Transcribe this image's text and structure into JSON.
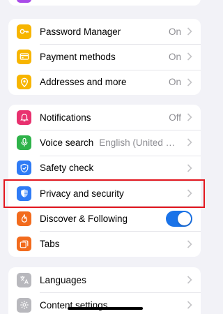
{
  "colors": {
    "background": "#f2f2f7",
    "highlight_border": "#e3171f",
    "toggle_on": "#1a73e8",
    "secondary_text": "#8e8e93"
  },
  "autofill_group": [
    {
      "label": "Password Manager",
      "value": "On",
      "icon": "key-icon",
      "icon_color": "#f7b500"
    },
    {
      "label": "Payment methods",
      "value": "On",
      "icon": "credit-card-icon",
      "icon_color": "#f7b500"
    },
    {
      "label": "Addresses and more",
      "value": "On",
      "icon": "location-pin-icon",
      "icon_color": "#f7b500"
    }
  ],
  "settings_group": [
    {
      "label": "Notifications",
      "value": "Off",
      "icon": "bell-icon",
      "icon_color": "#e8316f"
    },
    {
      "label": "Voice search",
      "value": "English (United States)",
      "icon": "microphone-icon",
      "icon_color": "#2fb34a"
    },
    {
      "label": "Safety check",
      "value": "",
      "icon": "shield-check-icon",
      "icon_color": "#2f7bf5"
    },
    {
      "label": "Privacy and security",
      "value": "",
      "icon": "privacy-shield-icon",
      "icon_color": "#2f7bf5"
    },
    {
      "label": "Discover & Following",
      "toggle": true,
      "icon": "flame-icon",
      "icon_color": "#f26b1d"
    },
    {
      "label": "Tabs",
      "value": "",
      "icon": "tabs-icon",
      "icon_color": "#f26b1d"
    }
  ],
  "general_group": [
    {
      "label": "Languages",
      "value": "",
      "icon": "translate-icon",
      "icon_color": "#b8b8bd"
    },
    {
      "label": "Content settings",
      "value": "",
      "icon": "gear-icon",
      "icon_color": "#b8b8bd"
    }
  ]
}
